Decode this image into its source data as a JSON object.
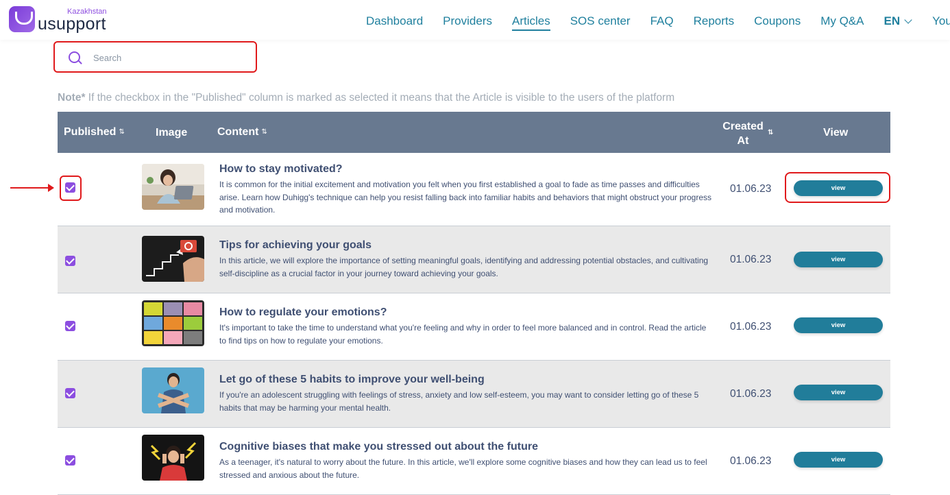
{
  "header": {
    "logo_country": "Kazakhstan",
    "logo_text": "usupport",
    "nav": [
      "Dashboard",
      "Providers",
      "Articles",
      "SOS center",
      "FAQ",
      "Reports",
      "Coupons",
      "My Q&A"
    ],
    "active_nav": "Articles",
    "language": "EN",
    "profile": "Your profile"
  },
  "search": {
    "placeholder": "Search"
  },
  "note": {
    "label": "Note*",
    "text": " If the checkbox in the \"Published\" column is marked as selected it means that the Article is visible to the users of the platform"
  },
  "table": {
    "columns": {
      "published": "Published",
      "image": "Image",
      "content": "Content",
      "created_line1": "Created",
      "created_line2": "At",
      "view": "View"
    },
    "rows": [
      {
        "published": true,
        "title": "How to stay motivated?",
        "description": "It is common for the initial excitement and motivation you felt when you first established a goal to fade as time passes and difficulties arise. Learn how Duhigg's technique can help you resist falling back into familiar habits and behaviors that might obstruct your progress and motivation.",
        "created": "01.06.23",
        "view_label": "view"
      },
      {
        "published": true,
        "title": "Tips for achieving your goals",
        "description": "In this article, we will explore the importance of setting meaningful goals, identifying and addressing potential obstacles, and cultivating self-discipline as a crucial factor in your journey toward achieving your goals.",
        "created": "01.06.23",
        "view_label": "view"
      },
      {
        "published": true,
        "title": "How to regulate your emotions?",
        "description": "It's important to take the time to understand what you're feeling and why in order to feel more balanced and in control. Read the article to find tips on how to regulate your emotions.",
        "created": "01.06.23",
        "view_label": "view"
      },
      {
        "published": true,
        "title": "Let go of these 5 habits to improve your well-being",
        "description": "If you're an adolescent struggling with feelings of stress, anxiety and low self-esteem, you may want to consider letting go of these 5 habits that may be harming your mental health.",
        "created": "01.06.23",
        "view_label": "view"
      },
      {
        "published": true,
        "title": "Cognitive biases that make you stressed out about the future",
        "description": "As a teenager, it's natural to worry about the future. In this article, we'll explore some cognitive biases and how they can lead us to feel stressed and anxious about the future.",
        "created": "01.06.23",
        "view_label": "view"
      }
    ]
  },
  "colors": {
    "primary": "#20809e",
    "accent_purple": "#8c4ee0",
    "header_bg": "#687990",
    "highlight_red": "#e0191b"
  }
}
